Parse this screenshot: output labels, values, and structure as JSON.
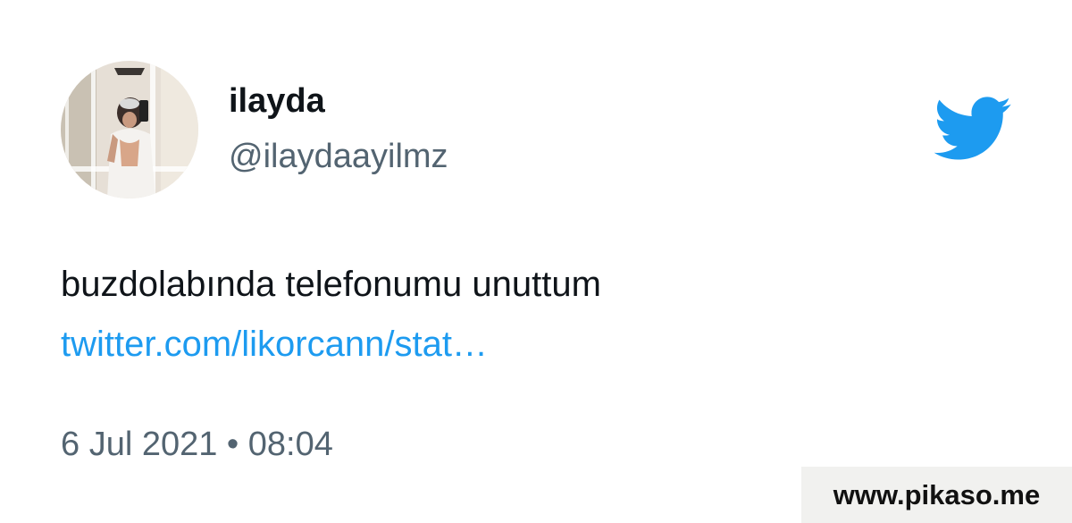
{
  "user": {
    "display_name": "ilayda",
    "handle": "@ilaydaayilmz"
  },
  "tweet": {
    "text": "buzdolabında telefonumu unuttum",
    "link": "twitter.com/likorcann/stat…",
    "timestamp": "6 Jul 2021 • 08:04"
  },
  "icons": {
    "brand": "twitter-bird-icon",
    "avatar": "avatar"
  },
  "watermark": {
    "text": "www.pikaso.me"
  },
  "colors": {
    "twitter_blue": "#1d9bf0",
    "text_primary": "#0f1419",
    "text_secondary": "#536471",
    "watermark_bg": "#f1f1ef"
  }
}
